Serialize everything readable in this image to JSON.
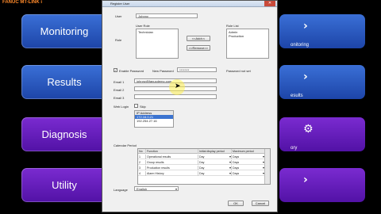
{
  "logo_text": "FANUC MT-LINK i",
  "menu_left": [
    {
      "label": "Monitoring",
      "color": "blue"
    },
    {
      "label": "Results",
      "color": "blue"
    },
    {
      "label": "Diagnosis",
      "color": "purple"
    },
    {
      "label": "Utility",
      "color": "purple"
    }
  ],
  "menu_right": [
    {
      "glyph": "›",
      "label": "onitoring"
    },
    {
      "glyph": "›",
      "label": "esults"
    },
    {
      "glyph": "⚙",
      "label": "ory"
    },
    {
      "glyph": "›",
      "label": ""
    }
  ],
  "dialog": {
    "title": "Register User",
    "user_label": "User",
    "user_value": "Johnny",
    "user_role_label": "User Role",
    "role_label": "Role",
    "user_roles": [
      "Technician"
    ],
    "role_list_label": "Role List",
    "role_list": [
      "Admin",
      "Production"
    ],
    "add_button": "<<Add<<",
    "remove_button": ">>Remove>>",
    "enable_password_label": "Enable Password",
    "new_password_label": "New Password",
    "new_password_value": "********",
    "password_not_set": "Password not set",
    "email1_label": "Email 1",
    "email1_value": "johnny@fanucdemo.com",
    "email2_label": "Email 2",
    "email3_label": "Email 3",
    "web_login_label": "Web Login",
    "web_login_option": "Skip",
    "ip_header": "IP Address",
    "ip_list": [
      "172.16.0.21",
      "192.254.27.16"
    ],
    "calendar_label": "Calendar Period",
    "grid_headers": [
      "No",
      "Function",
      "Initial display period",
      "Maximum period"
    ],
    "grid_rows": [
      {
        "no": "1",
        "fn": "Operational results",
        "init": "Day",
        "max": "Days"
      },
      {
        "no": "2",
        "fn": "Group results",
        "init": "Day",
        "max": "Days"
      },
      {
        "no": "3",
        "fn": "Production results",
        "init": "Day",
        "max": "Days"
      },
      {
        "no": "4",
        "fn": "Alarm History",
        "init": "Day",
        "max": "Days"
      }
    ],
    "language_label": "Language",
    "language_value": "English",
    "ok_button": "OK",
    "cancel_button": "Cancel"
  }
}
